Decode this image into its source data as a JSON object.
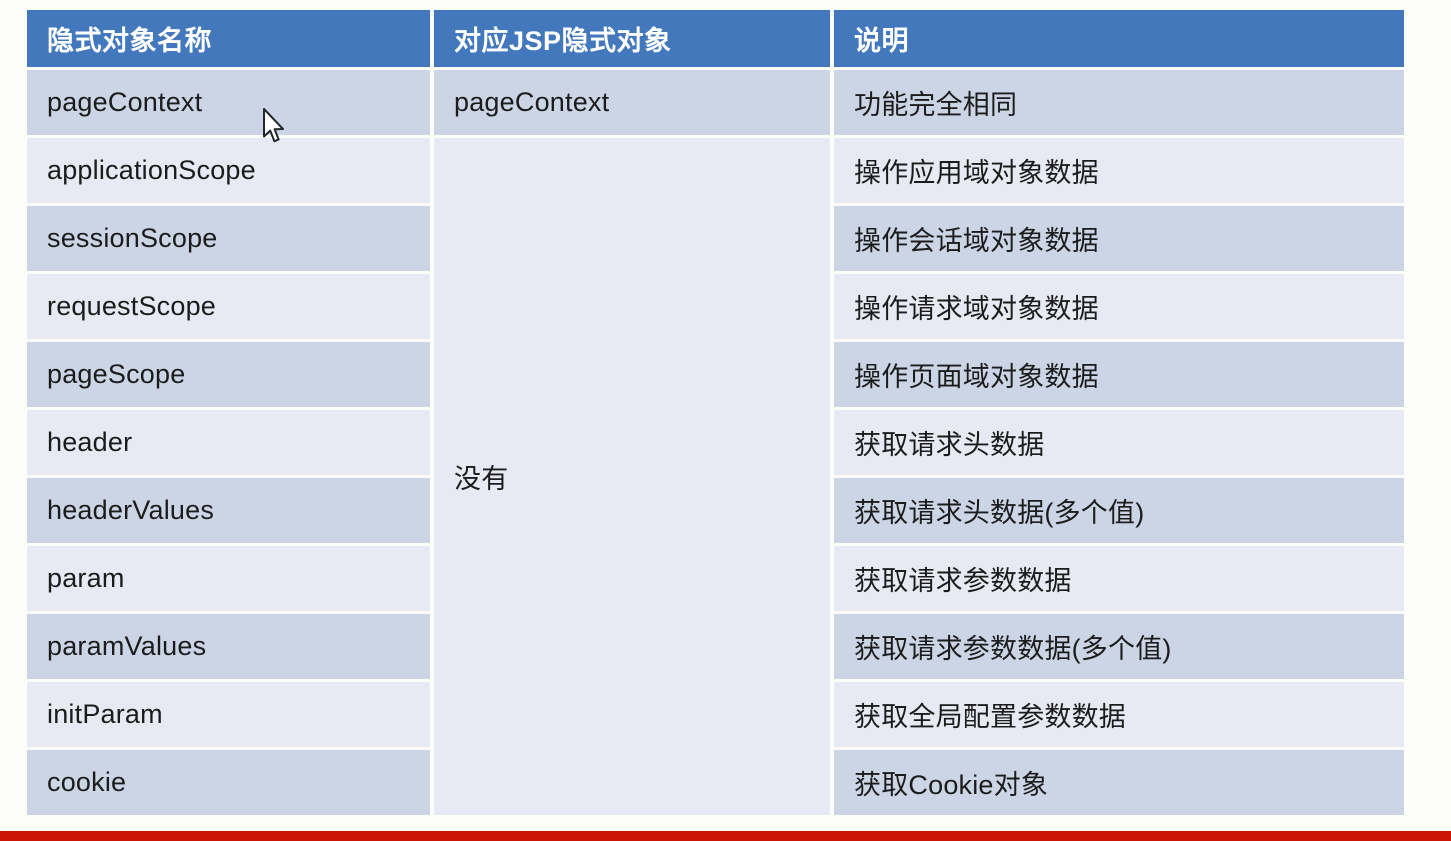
{
  "table": {
    "headers": [
      "隐式对象名称",
      "对应JSP隐式对象",
      "说明"
    ],
    "merged_cell_label": "没有",
    "rows": [
      {
        "name": "pageContext",
        "jsp": "pageContext",
        "desc": "功能完全相同"
      },
      {
        "name": "applicationScope",
        "jsp": "",
        "desc": "操作应用域对象数据"
      },
      {
        "name": "sessionScope",
        "jsp": "",
        "desc": "操作会话域对象数据"
      },
      {
        "name": "requestScope",
        "jsp": "",
        "desc": "操作请求域对象数据"
      },
      {
        "name": "pageScope",
        "jsp": "",
        "desc": "操作页面域对象数据"
      },
      {
        "name": "header",
        "jsp": "",
        "desc": "获取请求头数据"
      },
      {
        "name": "headerValues",
        "jsp": "",
        "desc": "获取请求头数据(多个值)"
      },
      {
        "name": "param",
        "jsp": "",
        "desc": "获取请求参数数据"
      },
      {
        "name": "paramValues",
        "jsp": "",
        "desc": "获取请求参数数据(多个值)"
      },
      {
        "name": "initParam",
        "jsp": "",
        "desc": "获取全局配置参数数据"
      },
      {
        "name": "cookie",
        "jsp": "",
        "desc": "获取Cookie对象"
      }
    ]
  },
  "colors": {
    "header_blue": "#4378bc",
    "stripe_dark": "#ccd5e6",
    "stripe_light": "#e7eaf2",
    "page_background": "#fdfdfa",
    "bottom_bar_red": "#cc1505"
  }
}
